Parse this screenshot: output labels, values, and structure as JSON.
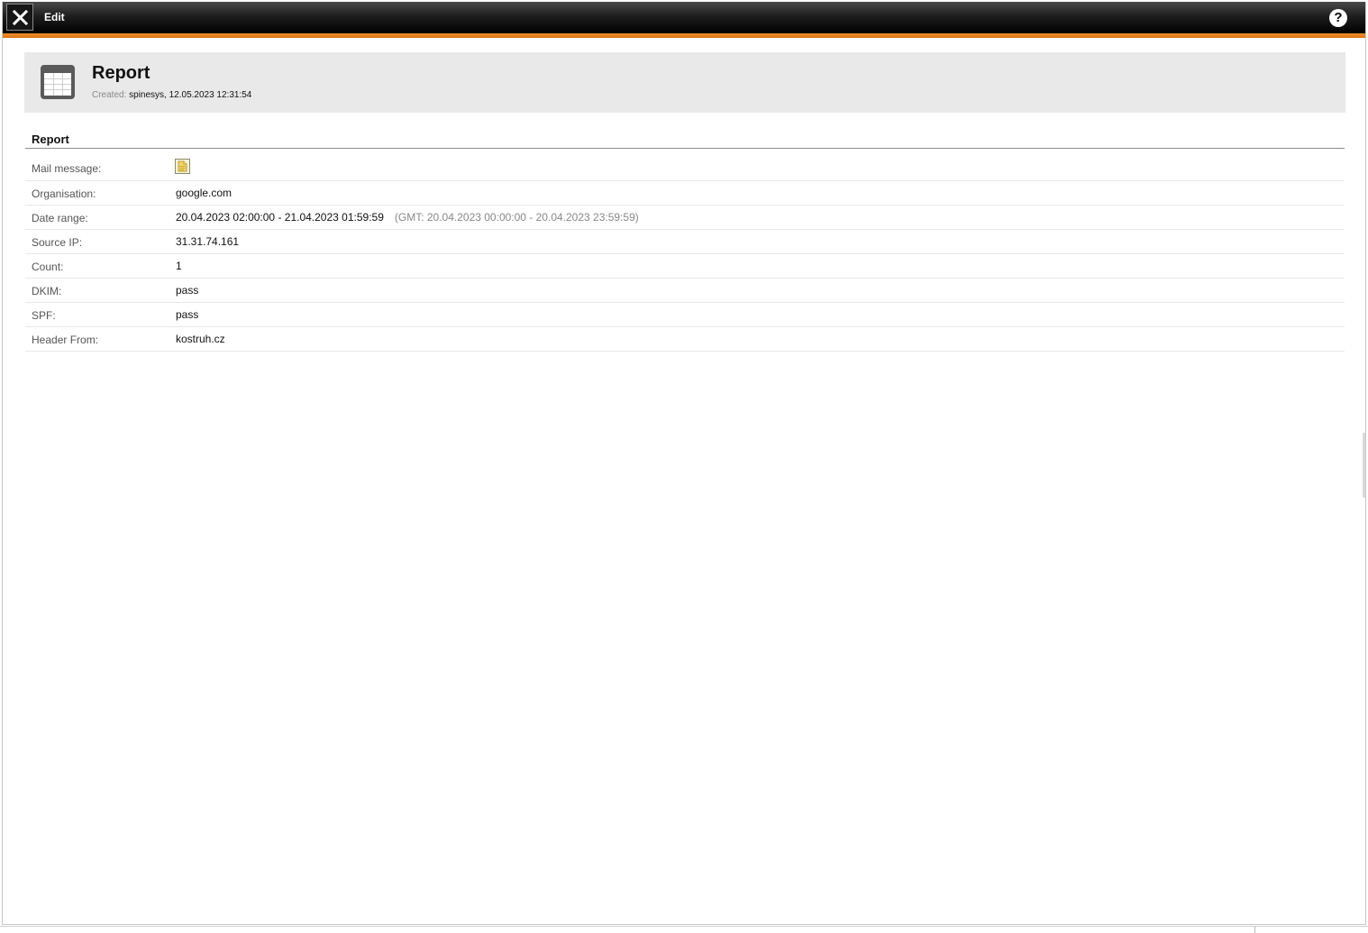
{
  "titlebar": {
    "title": "Edit",
    "close_icon": "close-icon",
    "help_icon": "help-icon",
    "help_glyph": "?"
  },
  "header": {
    "icon": "table-icon",
    "title": "Report",
    "created_label": "Created:",
    "created_value": "spinesys, 12.05.2023 12:31:54"
  },
  "section": {
    "title": "Report"
  },
  "fields": {
    "mail_message": {
      "label": "Mail message:",
      "icon": "document-icon"
    },
    "organisation": {
      "label": "Organisation:",
      "value": "google.com"
    },
    "date_range": {
      "label": "Date range:",
      "value": "20.04.2023 02:00:00 - 21.04.2023 01:59:59",
      "gmt": "(GMT: 20.04.2023 00:00:00 - 20.04.2023 23:59:59)"
    },
    "source_ip": {
      "label": "Source IP:",
      "value": "31.31.74.161"
    },
    "count": {
      "label": "Count:",
      "value": "1"
    },
    "dkim": {
      "label": "DKIM:",
      "value": "pass"
    },
    "spf": {
      "label": "SPF:",
      "value": "pass"
    },
    "header_from": {
      "label": "Header From:",
      "value": "kostruh.cz"
    }
  },
  "colors": {
    "accent": "#e07a10",
    "titlebar": "#1e1e1e",
    "header_panel": "#e9e9e9"
  }
}
